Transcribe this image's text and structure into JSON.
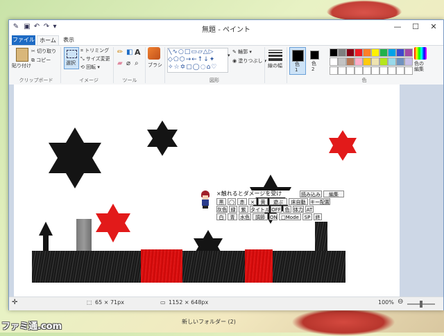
{
  "window": {
    "title": "無題 - ペイント",
    "minimize": "—",
    "maximize": "☐",
    "close": "✕"
  },
  "tabs": [
    "ファイル",
    "ホーム",
    "表示"
  ],
  "ribbon": {
    "clipboard": {
      "paste": "貼り付け",
      "cut": "切り取り",
      "copy": "コピー",
      "group": "クリップボード"
    },
    "image": {
      "select": "選択",
      "crop": "トリミング",
      "resize": "サイズ変更",
      "rotate": "回転",
      "group": "イメージ"
    },
    "tools": {
      "group": "ツール"
    },
    "brush": {
      "label": "ブラシ"
    },
    "shapes": {
      "outline": "輪郭",
      "fill": "塗りつぶし",
      "group": "図形"
    },
    "size": {
      "label": "線の幅"
    },
    "color1": {
      "label": "色\n1"
    },
    "color2": {
      "label": "色\n2"
    },
    "colors": {
      "group": "色",
      "edit": "色の\n編集"
    },
    "palette": [
      "#000000",
      "#7f7f7f",
      "#880015",
      "#ed1c24",
      "#ff7f27",
      "#fff200",
      "#22b14c",
      "#00a2e8",
      "#3f48cc",
      "#a349a4",
      "#ffffff",
      "#c3c3c3",
      "#b97a57",
      "#ffaec9",
      "#ffc90e",
      "#efe4b0",
      "#b5e61d",
      "#99d9ea",
      "#7092be",
      "#c8bfe7"
    ]
  },
  "game_menu": {
    "title": "×触れるとダメージを受け",
    "load": "読み込み",
    "edit": "編集",
    "row2": [
      "黒",
      "◯",
      "赤",
      "×",
      "黄",
      "遊ぶ",
      "床自動",
      "キー配置"
    ],
    "row3": [
      "灰色",
      "緑",
      "紫",
      "タイトル",
      "OFF",
      "色",
      "体力",
      "AT"
    ],
    "row4": [
      "白",
      "青",
      "水色",
      "調節",
      "ON",
      "□Mode",
      "SP",
      "終"
    ]
  },
  "statusbar": {
    "selection": "65 × 71px",
    "canvas_size": "1152 × 648px",
    "zoom": "100%"
  },
  "taskbar": {
    "label": "新しいフォルダー (2)"
  },
  "watermark": "ファミ通.com"
}
